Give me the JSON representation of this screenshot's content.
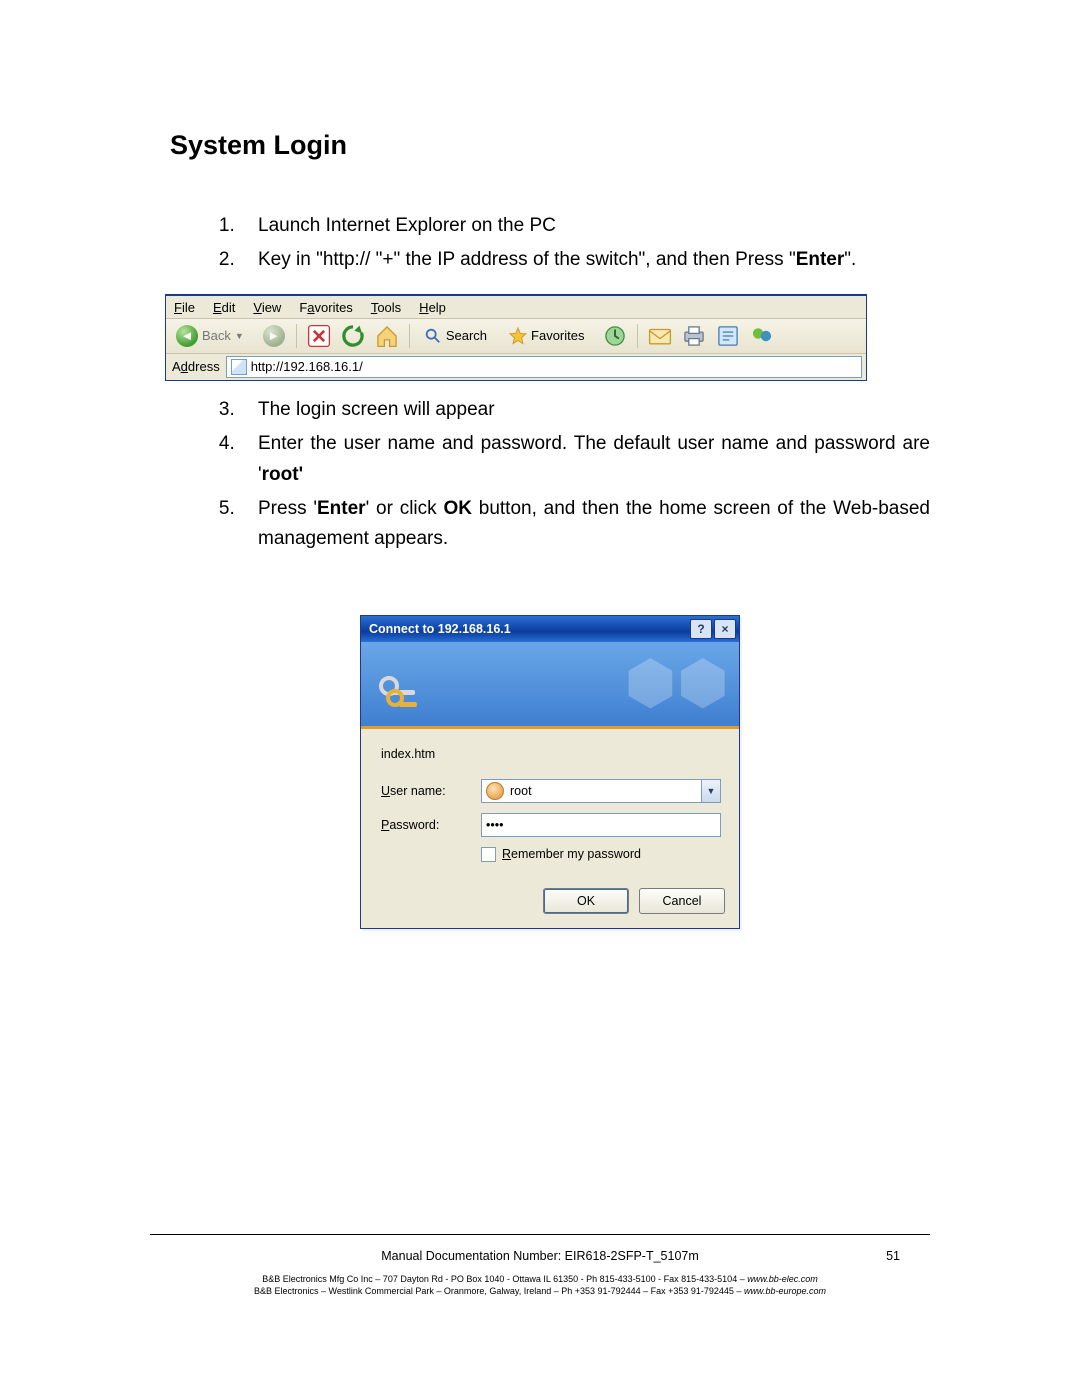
{
  "heading": "System Login",
  "steps": {
    "s1": "Launch Internet Explorer on the PC",
    "s2a": "Key in \"http:// \"+\" the IP address of the switch\", and then Press \"",
    "s2b": "Enter",
    "s2c": "\".",
    "s3": "The login screen will appear",
    "s4a": "Enter the user name and password. The default user name and password are '",
    "s4b": "root'",
    "s5a": "Press '",
    "s5b": "Enter",
    "s5c": "' or click ",
    "s5d": "OK",
    "s5e": " button, and then the home screen of the Web-based management appears."
  },
  "ie": {
    "menu": {
      "file": "File",
      "edit": "Edit",
      "view": "View",
      "favorites": "Favorites",
      "tools": "Tools",
      "help": "Help"
    },
    "back": "Back",
    "search": "Search",
    "favorites_btn": "Favorites",
    "address_label": "Address",
    "address_value": "http://192.168.16.1/"
  },
  "dialog": {
    "title": "Connect to 192.168.16.1",
    "realm": "index.htm",
    "user_label": "User name:",
    "pass_label": "Password:",
    "user_value": "root",
    "pass_mask": "••••",
    "remember": "Remember my password",
    "ok": "OK",
    "cancel": "Cancel"
  },
  "footer": {
    "doc_number": "Manual Documentation Number: EIR618-2SFP-T_5107m",
    "page_number": "51",
    "line1a": "B&B Electronics Mfg Co Inc – 707 Dayton Rd - PO Box 1040 - Ottawa IL 61350 - Ph 815-433-5100 - Fax 815-433-5104 – ",
    "line1b": "www.bb-elec.com",
    "line2a": "B&B Electronics – Westlink Commercial Park – Oranmore, Galway, Ireland – Ph +353 91-792444 – Fax +353 91-792445 – ",
    "line2b": "www.bb-europe.com"
  }
}
